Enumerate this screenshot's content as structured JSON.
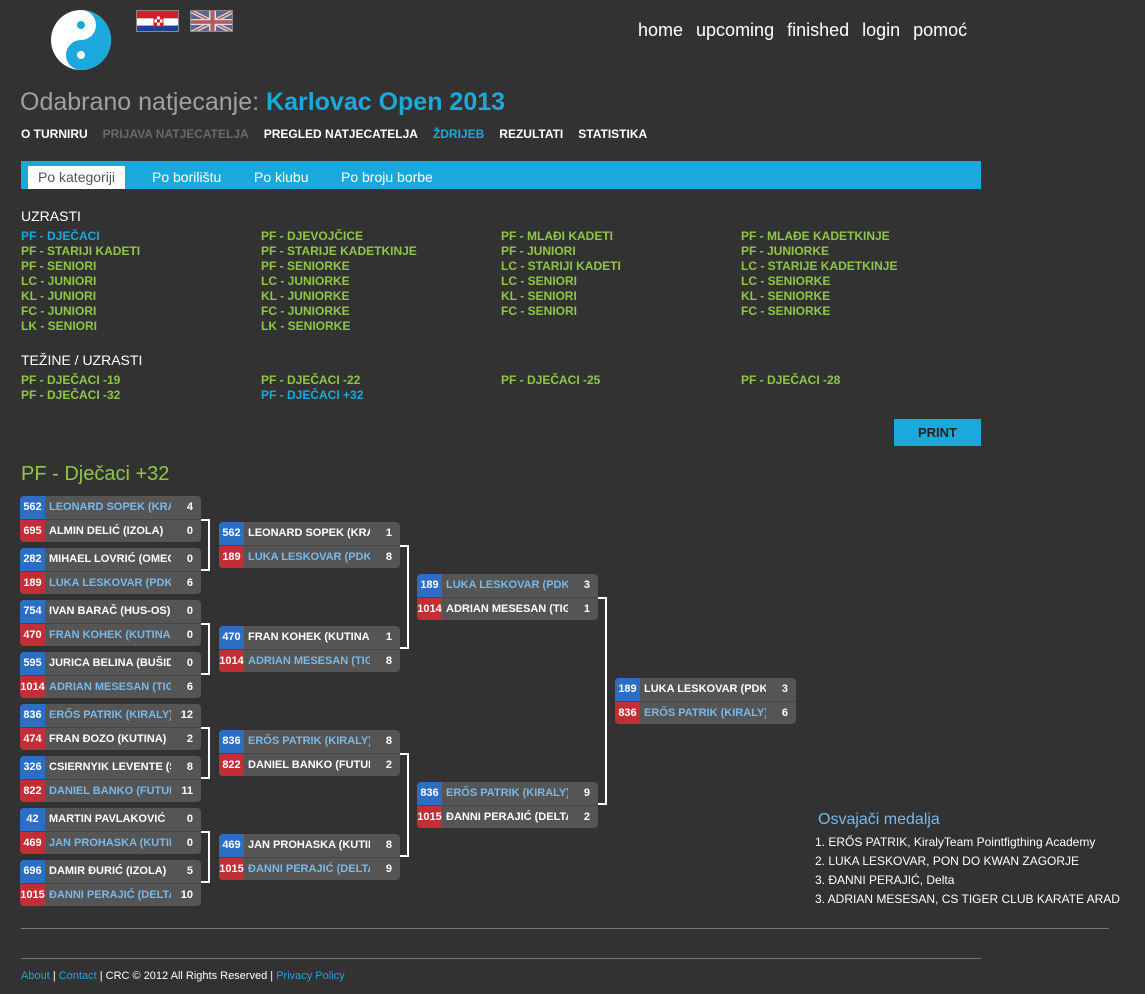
{
  "header": {
    "nav": [
      "home",
      "upcoming",
      "finished",
      "login",
      "pomoć"
    ]
  },
  "competition": {
    "label": "Odabrano natjecanje:",
    "name": "Karlovac Open 2013"
  },
  "subnav": [
    {
      "label": "O TURNIRU",
      "state": "normal"
    },
    {
      "label": "PRIJAVA NATJECATELJA",
      "state": "disabled"
    },
    {
      "label": "PREGLED NATJECATELJA",
      "state": "normal"
    },
    {
      "label": "ŽDRIJEB",
      "state": "active"
    },
    {
      "label": "REZULTATI",
      "state": "normal"
    },
    {
      "label": "STATISTIKA",
      "state": "normal"
    }
  ],
  "tabs": [
    {
      "label": "Po kategoriji",
      "active": true
    },
    {
      "label": "Po borilištu",
      "active": false
    },
    {
      "label": "Po klubu",
      "active": false
    },
    {
      "label": "Po broju borbe",
      "active": false
    }
  ],
  "uzrasti": {
    "heading": "UZRASTI",
    "items": [
      "PF - DJEČACI",
      "PF - DJEVOJČICE",
      "PF - MLAĐI KADETI",
      "PF - MLAĐE KADETKINJE",
      "PF - STARIJI KADETI",
      "PF - STARIJE KADETKINJE",
      "PF - JUNIORI",
      "PF - JUNIORKE",
      "PF - SENIORI",
      "PF - SENIORKE",
      "LC - STARIJI KADETI",
      "LC - STARIJE KADETKINJE",
      "LC - JUNIORI",
      "LC - JUNIORKE",
      "LC - SENIORI",
      "LC - SENIORKE",
      "KL - JUNIORI",
      "KL - JUNIORKE",
      "KL - SENIORI",
      "KL - SENIORKE",
      "FC - JUNIORI",
      "FC - JUNIORKE",
      "FC - SENIORI",
      "FC - SENIORKE",
      "LK - SENIORI",
      "LK - SENIORKE"
    ],
    "selected": 0
  },
  "tezine": {
    "heading": "TEŽINE / UZRASTI",
    "items": [
      "PF - DJEČACI -19",
      "PF - DJEČACI -22",
      "PF - DJEČACI -25",
      "PF - DJEČACI -28",
      "PF - DJEČACI -32",
      "PF - DJEČACI +32"
    ],
    "selected": 5
  },
  "print_label": "PRINT",
  "bracket": {
    "title": "PF - Dječaci +32",
    "rounds": [
      [
        [
          {
            "seed": "562",
            "name": "LEONARD SOPEK (KRAPINA)",
            "score": "4",
            "win": true
          },
          {
            "seed": "695",
            "name": "ALMIN DELIĆ (IZOLA)",
            "score": "0",
            "win": false
          }
        ],
        [
          {
            "seed": "282",
            "name": "MIHAEL LOVRIĆ (OMEGA)",
            "score": "0",
            "win": false
          },
          {
            "seed": "189",
            "name": "LUKA LESKOVAR (PDK ZAGORJE)",
            "score": "6",
            "win": true
          }
        ],
        [
          {
            "seed": "754",
            "name": "IVAN BARAČ (HUS-OS)",
            "score": "0",
            "win": false
          },
          {
            "seed": "470",
            "name": "FRAN KOHEK (KUTINA)",
            "score": "0",
            "win": true
          }
        ],
        [
          {
            "seed": "595",
            "name": "JURICA BELINA (BUŠIDO)",
            "score": "0",
            "win": false
          },
          {
            "seed": "1014",
            "name": "ADRIAN MESESAN (TIGER)",
            "score": "6",
            "win": true
          }
        ],
        [
          {
            "seed": "836",
            "name": "ERŐS PATRIK (KIRALY)",
            "score": "12",
            "win": true
          },
          {
            "seed": "474",
            "name": "FRAN ĐOZO (KUTINA)",
            "score": "2",
            "win": false
          }
        ],
        [
          {
            "seed": "326",
            "name": "CSIERNYIK LEVENTE (SZEGED)",
            "score": "8",
            "win": false
          },
          {
            "seed": "822",
            "name": "DANIEL BANKO (FUTURA)",
            "score": "11",
            "win": true
          }
        ],
        [
          {
            "seed": "42",
            "name": "MARTIN PAVLAKOVIĆ",
            "score": "0",
            "win": false
          },
          {
            "seed": "469",
            "name": "JAN PROHASKA (KUTINA)",
            "score": "0",
            "win": true
          }
        ],
        [
          {
            "seed": "696",
            "name": "DAMIR ĐURIĆ (IZOLA)",
            "score": "5",
            "win": false
          },
          {
            "seed": "1015",
            "name": "ĐANNI PERAJIĆ (DELTA)",
            "score": "10",
            "win": true
          }
        ]
      ],
      [
        [
          {
            "seed": "562",
            "name": "LEONARD SOPEK (KRAPINA)",
            "score": "1",
            "win": false
          },
          {
            "seed": "189",
            "name": "LUKA LESKOVAR (PDK ZAGORJE)",
            "score": "8",
            "win": true
          }
        ],
        [
          {
            "seed": "470",
            "name": "FRAN KOHEK (KUTINA)",
            "score": "1",
            "win": false
          },
          {
            "seed": "1014",
            "name": "ADRIAN MESESAN (TIGER)",
            "score": "8",
            "win": true
          }
        ],
        [
          {
            "seed": "836",
            "name": "ERŐS PATRIK (KIRALY)",
            "score": "8",
            "win": true
          },
          {
            "seed": "822",
            "name": "DANIEL BANKO (FUTURA)",
            "score": "2",
            "win": false
          }
        ],
        [
          {
            "seed": "469",
            "name": "JAN PROHASKA (KUTINA)",
            "score": "8",
            "win": false
          },
          {
            "seed": "1015",
            "name": "ĐANNI PERAJIĆ (DELTA)",
            "score": "9",
            "win": true
          }
        ]
      ],
      [
        [
          {
            "seed": "189",
            "name": "LUKA LESKOVAR (PDK ZAGORJE)",
            "score": "3",
            "win": true
          },
          {
            "seed": "1014",
            "name": "ADRIAN MESESAN (TIGER)",
            "score": "1",
            "win": false
          }
        ],
        [
          {
            "seed": "836",
            "name": "ERŐS PATRIK (KIRALY)",
            "score": "9",
            "win": true
          },
          {
            "seed": "1015",
            "name": "ĐANNI PERAJIĆ (DELTA)",
            "score": "2",
            "win": false
          }
        ]
      ],
      [
        [
          {
            "seed": "189",
            "name": "LUKA LESKOVAR (PDK ZAGORJE)",
            "score": "3",
            "win": false
          },
          {
            "seed": "836",
            "name": "ERŐS PATRIK (KIRALY)",
            "score": "6",
            "win": true
          }
        ]
      ]
    ]
  },
  "medals": {
    "title": "Osvajači medalja",
    "items": [
      "1. ERŐS PATRIK, KiralyTeam Pointfigthing Academy",
      "2. LUKA LESKOVAR, PON DO KWAN ZAGORJE",
      "3. ĐANNI PERAJIĆ, Delta",
      "3. ADRIAN MESESAN, CS TIGER CLUB KARATE ARAD"
    ]
  },
  "footer": {
    "about": "About",
    "contact": "Contact",
    "copyright": "CRC © 2012 All Rights Reserved",
    "privacy": "Privacy Policy"
  },
  "colors": {
    "background": "#323232",
    "accent": "#1ba8dc",
    "category": "#8ec647",
    "blue_corner": "#2d6ec5",
    "red_corner": "#c12e35"
  }
}
